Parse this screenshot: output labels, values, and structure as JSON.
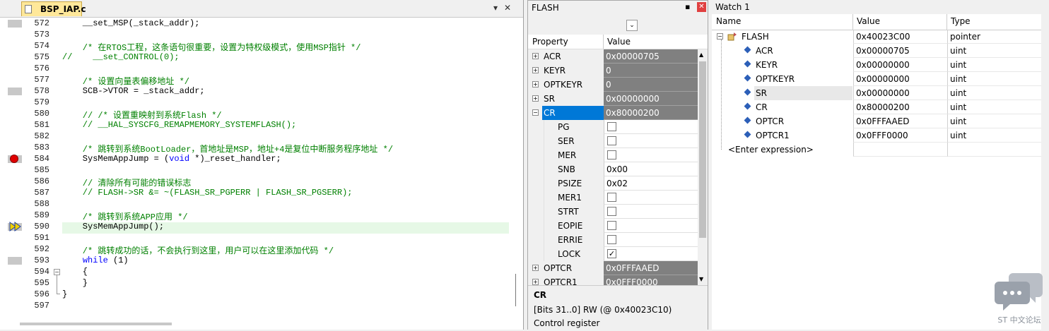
{
  "editor": {
    "file_tab": "BSP_IAP.c",
    "pin_btn": "▾",
    "close_btn": "✕",
    "lines": [
      {
        "num": "572",
        "code": "    __set_MSP(_stack_addr);",
        "mark": true
      },
      {
        "num": "573",
        "code": ""
      },
      {
        "num": "574",
        "code": "    /* 在RTOS工程，这条语句很重要，设置为特权级模式，使用MSP指针 */",
        "comment": true
      },
      {
        "num": "575",
        "code": "//    __set_CONTROL(0);",
        "comment": true
      },
      {
        "num": "576",
        "code": ""
      },
      {
        "num": "577",
        "code": "    /* 设置向量表偏移地址 */",
        "comment": true
      },
      {
        "num": "578",
        "code": "    SCB->VTOR = _stack_addr;",
        "mark": true
      },
      {
        "num": "579",
        "code": ""
      },
      {
        "num": "580",
        "code": "    // /* 设置重映射到系统Flash */",
        "comment": true
      },
      {
        "num": "581",
        "code": "    // __HAL_SYSCFG_REMAPMEMORY_SYSTEMFLASH();",
        "comment": true
      },
      {
        "num": "582",
        "code": ""
      },
      {
        "num": "583",
        "code": "    /* 跳转到系统BootLoader，首地址是MSP，地址+4是复位中断服务程序地址 */",
        "comment": true
      },
      {
        "num": "584",
        "code": "    SysMemAppJump = (void *)_reset_handler;",
        "breakpoint": true
      },
      {
        "num": "585",
        "code": ""
      },
      {
        "num": "586",
        "code": "    // 清除所有可能的错误标志",
        "comment": true
      },
      {
        "num": "587",
        "code": "    // FLASH->SR &= ~(FLASH_SR_PGPERR | FLASH_SR_PGSERR);",
        "comment": true
      },
      {
        "num": "588",
        "code": ""
      },
      {
        "num": "589",
        "code": "    /* 跳转到系统APP应用 */",
        "comment": true
      },
      {
        "num": "590",
        "code": "    SysMemAppJump();",
        "current": true
      },
      {
        "num": "591",
        "code": ""
      },
      {
        "num": "592",
        "code": "    /* 跳转成功的话，不会执行到这里，用户可以在这里添加代码 */",
        "comment": true
      },
      {
        "num": "593",
        "code_kw": "while",
        "code_rest": " (1)",
        "mark": true
      },
      {
        "num": "594",
        "code": "    {",
        "fold": true
      },
      {
        "num": "595",
        "code": "    }"
      },
      {
        "num": "596",
        "code": "}"
      },
      {
        "num": "597",
        "code": ""
      }
    ]
  },
  "flash_panel": {
    "title": "FLASH",
    "pin": "▪",
    "close": "✕",
    "dropdown": "⌄",
    "col_property": "Property",
    "col_value": "Value",
    "rows": [
      {
        "name": "ACR",
        "value": "0x00000705",
        "kind": "reg",
        "exp": "+"
      },
      {
        "name": "KEYR",
        "value": "0",
        "kind": "reg",
        "exp": "+"
      },
      {
        "name": "OPTKEYR",
        "value": "0",
        "kind": "reg",
        "exp": "+"
      },
      {
        "name": "SR",
        "value": "0x00000000",
        "kind": "reg",
        "exp": "+"
      },
      {
        "name": "CR",
        "value": "0x80000200",
        "kind": "reg",
        "exp": "−",
        "selected": true
      },
      {
        "name": "PG",
        "kind": "chk",
        "checked": false
      },
      {
        "name": "SER",
        "kind": "chk",
        "checked": false
      },
      {
        "name": "MER",
        "kind": "chk",
        "checked": false
      },
      {
        "name": "SNB",
        "value": "0x00",
        "kind": "fld"
      },
      {
        "name": "PSIZE",
        "value": "0x02",
        "kind": "fld"
      },
      {
        "name": "MER1",
        "kind": "chk",
        "checked": false
      },
      {
        "name": "STRT",
        "kind": "chk",
        "checked": false
      },
      {
        "name": "EOPIE",
        "kind": "chk",
        "checked": false
      },
      {
        "name": "ERRIE",
        "kind": "chk",
        "checked": false
      },
      {
        "name": "LOCK",
        "kind": "chk",
        "checked": true
      },
      {
        "name": "OPTCR",
        "value": "0x0FFFAAED",
        "kind": "reg",
        "exp": "+"
      },
      {
        "name": "OPTCR1",
        "value": "0x0FFF0000",
        "kind": "reg",
        "exp": "+"
      }
    ],
    "description": {
      "title": "CR",
      "text": "[Bits 31..0] RW (@ 0x40023C10) Control register"
    }
  },
  "watch_panel": {
    "title": "Watch 1",
    "col_name": "Name",
    "col_value": "Value",
    "col_type": "Type",
    "rows": [
      {
        "name": "FLASH",
        "value": "0x40023C00",
        "type": "pointer",
        "root": true
      },
      {
        "name": "ACR",
        "value": "0x00000705",
        "type": "uint"
      },
      {
        "name": "KEYR",
        "value": "0x00000000",
        "type": "uint"
      },
      {
        "name": "OPTKEYR",
        "value": "0x00000000",
        "type": "uint"
      },
      {
        "name": "SR",
        "value": "0x00000000",
        "type": "uint",
        "selected": true
      },
      {
        "name": "CR",
        "value": "0x80000200",
        "type": "uint"
      },
      {
        "name": "OPTCR",
        "value": "0x0FFFAAED",
        "type": "uint"
      },
      {
        "name": "OPTCR1",
        "value": "0x0FFF0000",
        "type": "uint"
      },
      {
        "name": "<Enter expression>",
        "value": "",
        "type": "",
        "enter": true
      }
    ],
    "watermark": "ST 中文论坛"
  },
  "colors": {
    "comment": "#008000",
    "keyword": "#0000ff",
    "current_line": "#e6f8e6",
    "breakpoint": "#e00000",
    "register_value_bg": "#808080",
    "selection": "#0078d7"
  }
}
